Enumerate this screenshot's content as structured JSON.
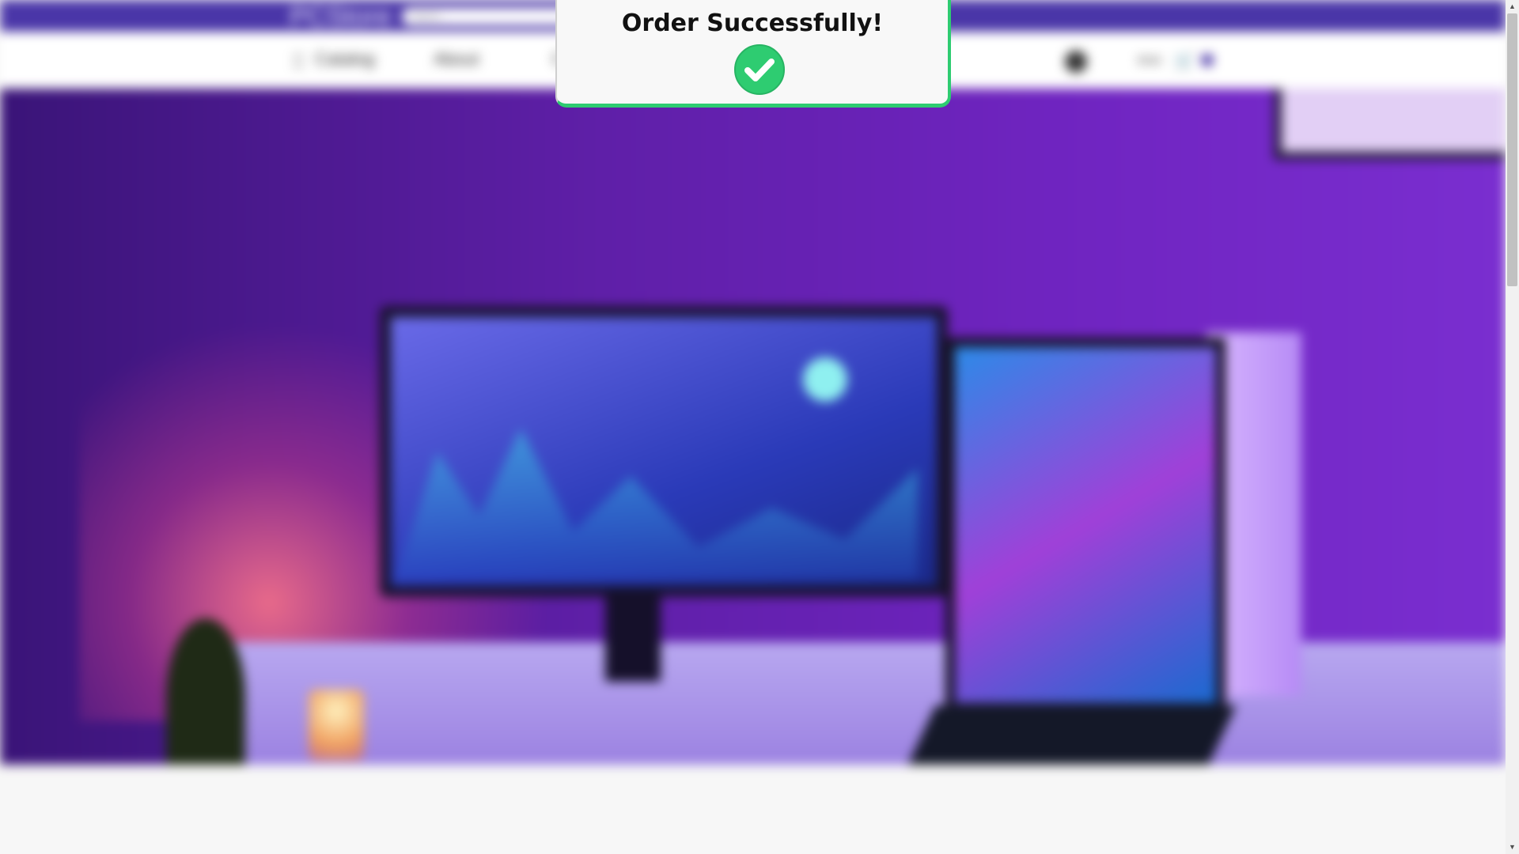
{
  "header": {
    "logo_text": "PCStore",
    "search_placeholder": "Search..."
  },
  "nav": {
    "catalog_label": "Catalog",
    "about_label": "About",
    "third_label": "C",
    "lang_label": "ENG"
  },
  "notification": {
    "title": "Order Successfully!",
    "icon": "check-circle-icon",
    "accent_color": "#2ecc71"
  },
  "colors": {
    "brand": "#4a36a8"
  },
  "scrollbar": {
    "up_glyph": "▲",
    "down_glyph": "▼"
  }
}
